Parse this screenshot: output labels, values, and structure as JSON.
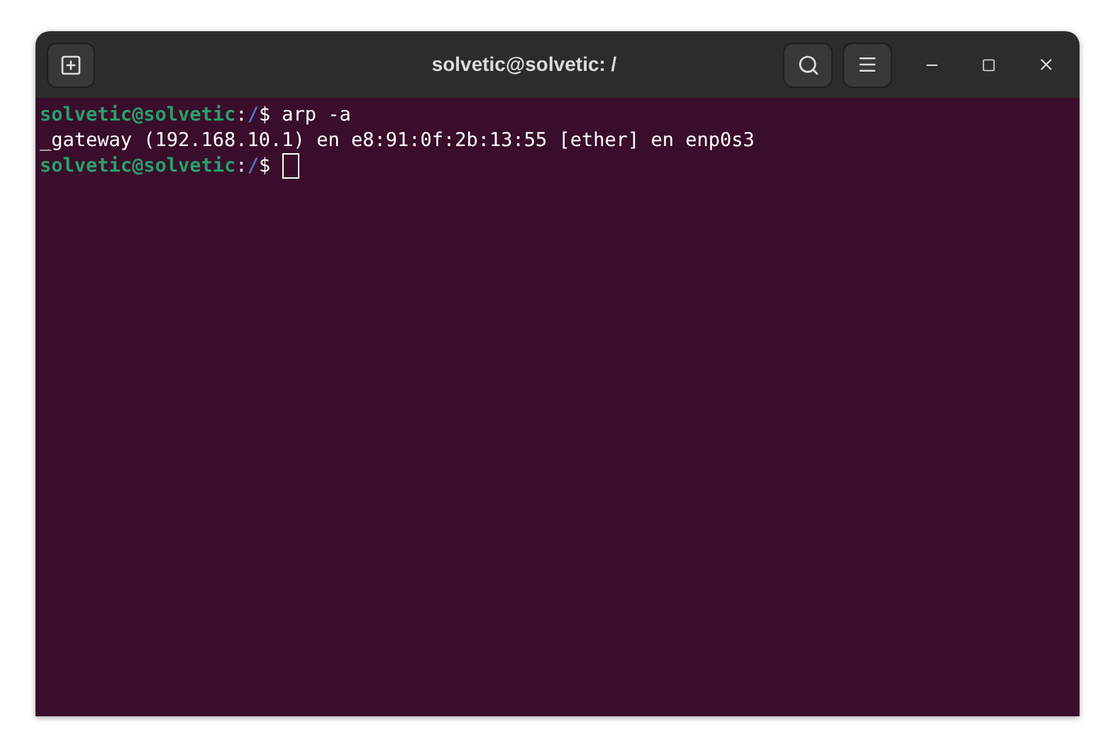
{
  "window": {
    "title": "solvetic@solvetic: /"
  },
  "terminal": {
    "lines": [
      {
        "kind": "prompt",
        "user_host": "solvetic@solvetic",
        "separator": ":",
        "path": "/",
        "symbol": "$",
        "command": "arp -a",
        "cursor": false
      },
      {
        "kind": "output",
        "text": "_gateway (192.168.10.1) en e8:91:0f:2b:13:55 [ether] en enp0s3"
      },
      {
        "kind": "prompt",
        "user_host": "solvetic@solvetic",
        "separator": ":",
        "path": "/",
        "symbol": "$",
        "cursor": true
      }
    ]
  }
}
